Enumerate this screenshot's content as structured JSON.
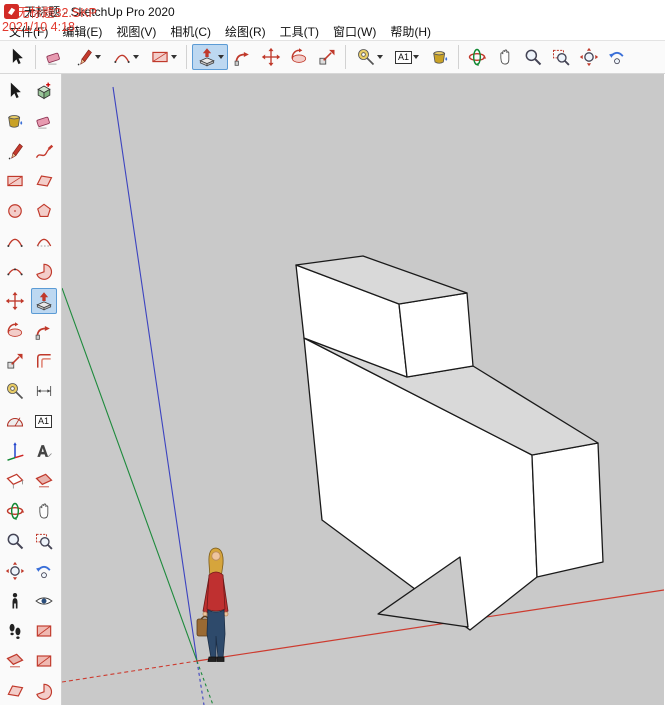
{
  "window": {
    "title": "无标题 - SketchUp Pro 2020"
  },
  "watermark": {
    "line1": "无标题32.SKP",
    "line2": "2021/10 4:18"
  },
  "menu_bar": {
    "items": [
      {
        "label": "文件(F)"
      },
      {
        "label": "编辑(E)"
      },
      {
        "label": "视图(V)"
      },
      {
        "label": "相机(C)"
      },
      {
        "label": "绘图(R)"
      },
      {
        "label": "工具(T)"
      },
      {
        "label": "窗口(W)"
      },
      {
        "label": "帮助(H)"
      }
    ]
  },
  "top_toolbar": {
    "active_tool": "push-pull",
    "icons": [
      "select-icon",
      "eraser-icon",
      "line-icon",
      "arc-icon",
      "rectangle-icon",
      "push-pull-icon",
      "follow-me-icon",
      "move-icon",
      "rotate-icon",
      "scale-icon",
      "tape-measure-icon",
      "text-icon",
      "paint-bucket-icon",
      "orbit-icon",
      "pan-icon",
      "zoom-icon",
      "zoom-window-icon",
      "zoom-extents-icon",
      "previous-view-icon"
    ]
  },
  "left_toolbar": {
    "active_tool": "push-pull",
    "icons": [
      "select-icon",
      "make-component-icon",
      "paint-bucket-icon",
      "eraser-icon",
      "line-icon",
      "freehand-icon",
      "rectangle-icon",
      "rotated-rectangle-icon",
      "circle-icon",
      "polygon-icon",
      "arc-icon",
      "two-point-arc-icon",
      "three-point-arc-icon",
      "pie-icon",
      "move-icon",
      "push-pull-icon",
      "rotate-icon",
      "follow-me-icon",
      "scale-icon",
      "offset-icon",
      "tape-measure-icon",
      "dimension-icon",
      "protractor-icon",
      "text-icon",
      "axes-icon",
      "3d-text-icon",
      "section-plane-icon",
      "section-fill-icon",
      "orbit-icon",
      "pan-icon",
      "zoom-icon",
      "zoom-window-icon",
      "zoom-extents-icon",
      "previous-view-icon",
      "position-camera-icon",
      "look-around-icon",
      "walk-icon",
      "section-display-icon",
      "style-icon-1",
      "style-icon-2",
      "style-icon-3",
      "style-icon-4"
    ]
  },
  "tool_icons": {
    "text_tool_label": "A1"
  },
  "viewport": {
    "background_color": "#c9c9c9",
    "axes_colors": {
      "red": "#cd3b2f",
      "green": "#1e8a3c",
      "blue": "#3c43c0"
    },
    "model_colors": {
      "front_faces": "#ffffff",
      "top_faces": "#d9d9d9",
      "edges": "#1a1a1a"
    },
    "person_colors": {
      "hair": "#d6a53c",
      "skin": "#eec49e",
      "jacket": "#bf3030",
      "jeans": "#2e4a6b",
      "bag": "#9a6a33"
    }
  }
}
